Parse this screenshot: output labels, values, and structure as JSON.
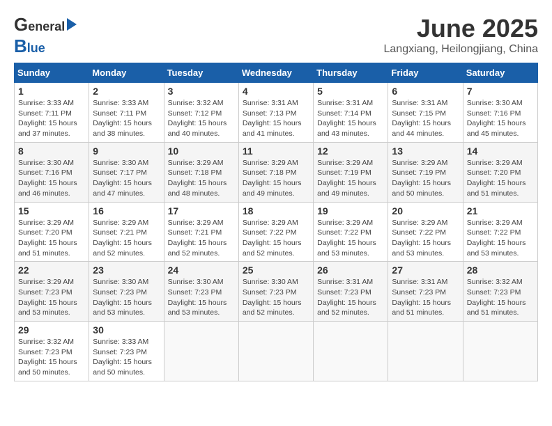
{
  "header": {
    "logo_top": "General",
    "logo_bottom": "Blue",
    "month": "June 2025",
    "location": "Langxiang, Heilongjiang, China"
  },
  "weekdays": [
    "Sunday",
    "Monday",
    "Tuesday",
    "Wednesday",
    "Thursday",
    "Friday",
    "Saturday"
  ],
  "weeks": [
    [
      {
        "day": "1",
        "info": "Sunrise: 3:33 AM\nSunset: 7:11 PM\nDaylight: 15 hours\nand 37 minutes."
      },
      {
        "day": "2",
        "info": "Sunrise: 3:33 AM\nSunset: 7:11 PM\nDaylight: 15 hours\nand 38 minutes."
      },
      {
        "day": "3",
        "info": "Sunrise: 3:32 AM\nSunset: 7:12 PM\nDaylight: 15 hours\nand 40 minutes."
      },
      {
        "day": "4",
        "info": "Sunrise: 3:31 AM\nSunset: 7:13 PM\nDaylight: 15 hours\nand 41 minutes."
      },
      {
        "day": "5",
        "info": "Sunrise: 3:31 AM\nSunset: 7:14 PM\nDaylight: 15 hours\nand 43 minutes."
      },
      {
        "day": "6",
        "info": "Sunrise: 3:31 AM\nSunset: 7:15 PM\nDaylight: 15 hours\nand 44 minutes."
      },
      {
        "day": "7",
        "info": "Sunrise: 3:30 AM\nSunset: 7:16 PM\nDaylight: 15 hours\nand 45 minutes."
      }
    ],
    [
      {
        "day": "8",
        "info": "Sunrise: 3:30 AM\nSunset: 7:16 PM\nDaylight: 15 hours\nand 46 minutes."
      },
      {
        "day": "9",
        "info": "Sunrise: 3:30 AM\nSunset: 7:17 PM\nDaylight: 15 hours\nand 47 minutes."
      },
      {
        "day": "10",
        "info": "Sunrise: 3:29 AM\nSunset: 7:18 PM\nDaylight: 15 hours\nand 48 minutes."
      },
      {
        "day": "11",
        "info": "Sunrise: 3:29 AM\nSunset: 7:18 PM\nDaylight: 15 hours\nand 49 minutes."
      },
      {
        "day": "12",
        "info": "Sunrise: 3:29 AM\nSunset: 7:19 PM\nDaylight: 15 hours\nand 49 minutes."
      },
      {
        "day": "13",
        "info": "Sunrise: 3:29 AM\nSunset: 7:19 PM\nDaylight: 15 hours\nand 50 minutes."
      },
      {
        "day": "14",
        "info": "Sunrise: 3:29 AM\nSunset: 7:20 PM\nDaylight: 15 hours\nand 51 minutes."
      }
    ],
    [
      {
        "day": "15",
        "info": "Sunrise: 3:29 AM\nSunset: 7:20 PM\nDaylight: 15 hours\nand 51 minutes."
      },
      {
        "day": "16",
        "info": "Sunrise: 3:29 AM\nSunset: 7:21 PM\nDaylight: 15 hours\nand 52 minutes."
      },
      {
        "day": "17",
        "info": "Sunrise: 3:29 AM\nSunset: 7:21 PM\nDaylight: 15 hours\nand 52 minutes."
      },
      {
        "day": "18",
        "info": "Sunrise: 3:29 AM\nSunset: 7:22 PM\nDaylight: 15 hours\nand 52 minutes."
      },
      {
        "day": "19",
        "info": "Sunrise: 3:29 AM\nSunset: 7:22 PM\nDaylight: 15 hours\nand 53 minutes."
      },
      {
        "day": "20",
        "info": "Sunrise: 3:29 AM\nSunset: 7:22 PM\nDaylight: 15 hours\nand 53 minutes."
      },
      {
        "day": "21",
        "info": "Sunrise: 3:29 AM\nSunset: 7:22 PM\nDaylight: 15 hours\nand 53 minutes."
      }
    ],
    [
      {
        "day": "22",
        "info": "Sunrise: 3:29 AM\nSunset: 7:23 PM\nDaylight: 15 hours\nand 53 minutes."
      },
      {
        "day": "23",
        "info": "Sunrise: 3:30 AM\nSunset: 7:23 PM\nDaylight: 15 hours\nand 53 minutes."
      },
      {
        "day": "24",
        "info": "Sunrise: 3:30 AM\nSunset: 7:23 PM\nDaylight: 15 hours\nand 53 minutes."
      },
      {
        "day": "25",
        "info": "Sunrise: 3:30 AM\nSunset: 7:23 PM\nDaylight: 15 hours\nand 52 minutes."
      },
      {
        "day": "26",
        "info": "Sunrise: 3:31 AM\nSunset: 7:23 PM\nDaylight: 15 hours\nand 52 minutes."
      },
      {
        "day": "27",
        "info": "Sunrise: 3:31 AM\nSunset: 7:23 PM\nDaylight: 15 hours\nand 51 minutes."
      },
      {
        "day": "28",
        "info": "Sunrise: 3:32 AM\nSunset: 7:23 PM\nDaylight: 15 hours\nand 51 minutes."
      }
    ],
    [
      {
        "day": "29",
        "info": "Sunrise: 3:32 AM\nSunset: 7:23 PM\nDaylight: 15 hours\nand 50 minutes."
      },
      {
        "day": "30",
        "info": "Sunrise: 3:33 AM\nSunset: 7:23 PM\nDaylight: 15 hours\nand 50 minutes."
      },
      {
        "day": "",
        "info": ""
      },
      {
        "day": "",
        "info": ""
      },
      {
        "day": "",
        "info": ""
      },
      {
        "day": "",
        "info": ""
      },
      {
        "day": "",
        "info": ""
      }
    ]
  ]
}
